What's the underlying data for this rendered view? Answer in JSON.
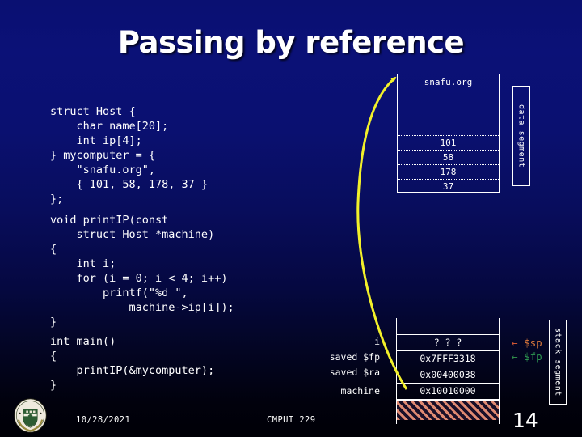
{
  "slide": {
    "title": "Passing by reference",
    "page_number": "14",
    "background_top_color": "#0a1072",
    "background_bottom_color": "#000006"
  },
  "code": {
    "struct_block": "struct Host {\n    char name[20];\n    int ip[4];\n} mycomputer = {\n    \"snafu.org\",\n    { 101, 58, 178, 37 }\n};",
    "function_block": "void printIP(const\n    struct Host *machine)\n{\n    int i;\n    for (i = 0; i < 4; i++)\n        printf(\"%d \",\n            machine->ip[i]);\n}",
    "main_block": "int main()\n{\n    printIP(&mycomputer);\n}"
  },
  "data_segment": {
    "label": "data segment",
    "name_value": "snafu.org",
    "ip_values": [
      "101",
      "58",
      "178",
      "37"
    ]
  },
  "stack_segment": {
    "label": "stack segment",
    "rows": [
      {
        "label": "",
        "value": ""
      },
      {
        "label": "i",
        "value": "? ? ?"
      },
      {
        "label": "saved $fp",
        "value": "0x7FFF3318"
      },
      {
        "label": "saved $ra",
        "value": "0x00400038"
      },
      {
        "label": "machine",
        "value": "0x10010000"
      }
    ],
    "pointers": [
      {
        "arrow": "←",
        "name": "$sp",
        "color": "#e07b3c"
      },
      {
        "arrow": "←",
        "name": "$fp",
        "color": "#2f9a52"
      }
    ]
  },
  "pointer_arrow": {
    "color": "#f2f02a",
    "from": "machine stack slot",
    "to": "data segment snafu.org"
  },
  "footer": {
    "date": "10/28/2021",
    "course": "CMPUT 229",
    "logo_name": "university-of-alberta-crest"
  }
}
